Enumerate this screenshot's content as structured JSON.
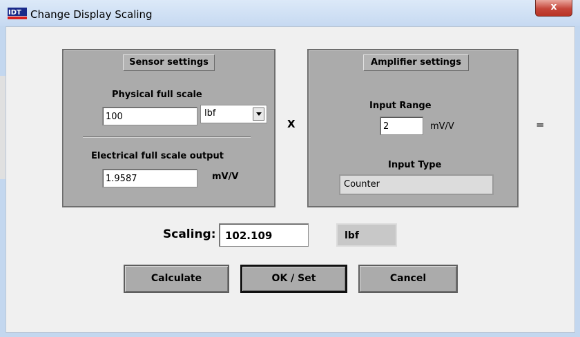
{
  "window": {
    "title": "Change Display Scaling",
    "app_icon": "idt-logo-icon",
    "close_glyph": "x"
  },
  "sensor": {
    "header": "Sensor settings",
    "physical_label": "Physical full scale",
    "physical_value": "100",
    "unit_selected": "lbf",
    "electrical_label": "Electrical full scale output",
    "electrical_value": "1.9587",
    "electrical_unit": "mV/V"
  },
  "operators": {
    "multiply": "X",
    "equals": "="
  },
  "amplifier": {
    "header": "Amplifier settings",
    "input_range_label": "Input Range",
    "input_range_value": "2",
    "input_range_unit": "mV/V",
    "input_type_label": "Input Type",
    "input_type_value": "Counter"
  },
  "scaling": {
    "label": "Scaling:",
    "value": "102.109",
    "unit": "lbf"
  },
  "buttons": {
    "calculate": "Calculate",
    "ok_set": "OK / Set",
    "cancel": "Cancel"
  }
}
